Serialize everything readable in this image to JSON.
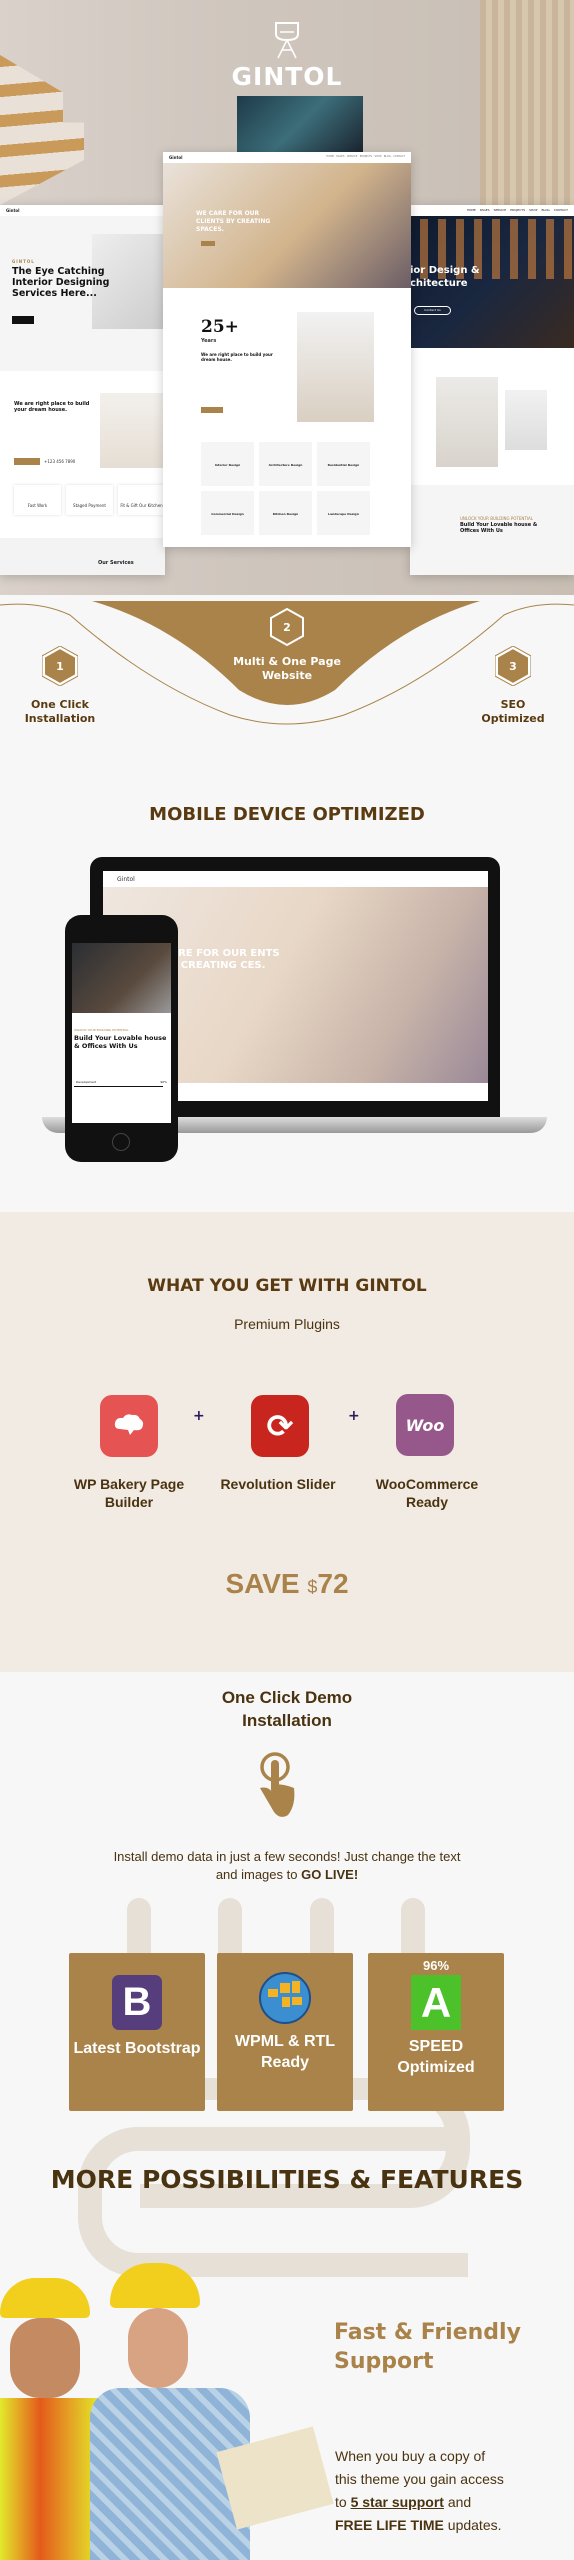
{
  "brand": {
    "name": "GINTOL",
    "logo_icon": "chair-icon"
  },
  "mockups": {
    "center": {
      "nav_logo": "Gintol",
      "nav_items": [
        "HOME",
        "PAGES",
        "SERVICE",
        "PROJECTS",
        "SHOP",
        "BLOG",
        "CONTACT"
      ],
      "hero_text": "WE CARE FOR OUR CLIENTS BY CREATING SPACES.",
      "years": "25+",
      "years_label": "Years",
      "about_heading": "We are right place to build your dream house.",
      "services": [
        "Interior Design",
        "Architecture Design",
        "Residential Design",
        "Commercial Design",
        "Kitchen Design",
        "Landscape Design"
      ]
    },
    "left": {
      "nav_logo": "Gintol",
      "eyebrow": "GINTOL",
      "heading": "The Eye Catching Interior Designing Services Here...",
      "about_heading": "We are right place to build your dream house.",
      "phone": "+123 456 7890",
      "features": [
        "Fast Work",
        "Staged Payment",
        "Fit & Gift Our Kitchen"
      ],
      "services_title": "Our Services"
    },
    "right": {
      "hero_text": "ior Design & chitecture",
      "button": "Contact Us",
      "eyebrow": "UNLOCK YOUR BUILDING POTENTIAL",
      "heading": "Build Your Lovable house & Offices With Us"
    }
  },
  "features_top": [
    {
      "num": "1",
      "label": "One Click Installation"
    },
    {
      "num": "2",
      "label": "Multi & One Page Website"
    },
    {
      "num": "3",
      "label": "SEO Optimized"
    }
  ],
  "mobile": {
    "title": "MOBILE DEVICE OPTIMIZED",
    "laptop_logo": "Gintol",
    "laptop_hero": "CARE FOR OUR ENTS BY CREATING CES.",
    "phone_eyebrow": "UNLOCK YOUR BUILDING POTENTIAL",
    "phone_heading": "Build Your Lovable house & Offices With Us",
    "phone_bar_label": "Development",
    "phone_bar_value": "90%"
  },
  "plugins": {
    "title": "WHAT YOU GET WITH GINTOL",
    "subtitle": "Premium Plugins",
    "items": [
      {
        "label": "WP Bakery Page Builder",
        "icon": "wpbakery-cloud-icon",
        "color": "#e55353"
      },
      {
        "label": "Revolution Slider",
        "icon": "revolution-refresh-icon",
        "color": "#c8251e"
      },
      {
        "label": "WooCommerce Ready",
        "icon": "woo-icon",
        "icon_text": "Woo",
        "color": "#96588a"
      }
    ],
    "plus": "+",
    "save_label": "SAVE",
    "save_currency": "$",
    "save_amount": "72"
  },
  "demo": {
    "title": "One Click Demo Installation",
    "icon": "hand-tap-icon",
    "desc": "Install demo data in just a few seconds! Just change the text and images to",
    "desc_bold": "GO LIVE!",
    "cards": [
      {
        "icon": "bootstrap-icon",
        "icon_text": "B",
        "label": "Latest Bootstrap"
      },
      {
        "icon": "wpml-globe-icon",
        "label": "WPML & RTL Ready"
      },
      {
        "icon": "speed-grade-icon",
        "icon_text": "A",
        "badge": "96%",
        "label": "SPEED Optimized"
      }
    ]
  },
  "more": {
    "title": "MORE POSSIBILITIES & FEATURES",
    "support_title": "Fast & Friendly Support",
    "support_text_1": "When you buy a copy of this theme you gain access to",
    "support_link": "5 star support",
    "support_text_2": "and",
    "support_bold": "FREE LIFE TIME",
    "support_text_3": "updates."
  },
  "colors": {
    "brand": "#a98349",
    "dark_brown": "#5a3a10",
    "beige": "#f2ebe3"
  }
}
